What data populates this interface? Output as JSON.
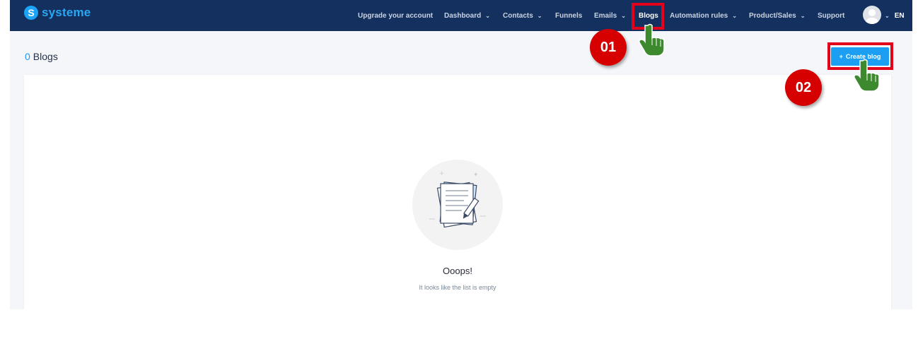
{
  "app": {
    "logo_text": "systeme",
    "logo_letter": "S"
  },
  "nav": {
    "items": [
      {
        "label": "Upgrade your account",
        "dropdown": false
      },
      {
        "label": "Dashboard",
        "dropdown": true
      },
      {
        "label": "Contacts",
        "dropdown": true
      },
      {
        "label": "Funnels",
        "dropdown": false
      },
      {
        "label": "Emails",
        "dropdown": true
      },
      {
        "label": "Blogs",
        "dropdown": false,
        "active": true
      },
      {
        "label": "Automation rules",
        "dropdown": true
      },
      {
        "label": "Product/Sales",
        "dropdown": true
      },
      {
        "label": "Support",
        "dropdown": false
      }
    ],
    "lang": "EN",
    "chevron": "⌄"
  },
  "page": {
    "count": "0",
    "title": "Blogs",
    "create_button": "Create blog",
    "create_icon": "+"
  },
  "empty": {
    "title": "Ooops!",
    "subtitle": "It looks like the list is empty"
  },
  "annotations": {
    "step1": "01",
    "step2": "02"
  },
  "colors": {
    "navbar": "#14305e",
    "accent": "#1c9ff2",
    "highlight": "#e3001b",
    "badge": "#d60000",
    "hand": "#3d8a2e"
  }
}
